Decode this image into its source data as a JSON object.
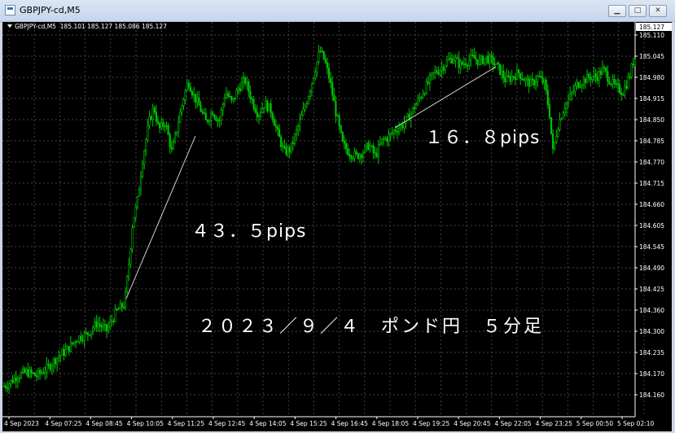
{
  "window": {
    "title": "GBPJPY-cd,M5",
    "buttons": [
      "minimize",
      "maximize",
      "close"
    ]
  },
  "chart_header": {
    "symbol_tf": "GBPJPY-cd,M5",
    "ohlc": "185.101 185.127 185.086 185.127"
  },
  "current_price": "185.127",
  "annotations": {
    "pips1": "４３．５pips",
    "pips2": "１６．８pips",
    "caption": "２０２３／９／４　ポンド円　５分足"
  },
  "colors": {
    "background": "#000000",
    "candle": "#00c000",
    "grid": "#5a5a5a",
    "text": "#ffffff"
  },
  "chart_data": {
    "type": "candlestick",
    "y_ticks": [
      "185.110",
      "185.045",
      "184.980",
      "184.915",
      "184.850",
      "184.785",
      "184.770",
      "184.715",
      "184.660",
      "184.605",
      "184.545",
      "184.490",
      "184.425",
      "184.360",
      "184.300",
      "184.235",
      "184.170",
      "184.160"
    ],
    "x_ticks": [
      "4 Sep 2023",
      "4 Sep 07:25",
      "4 Sep 08:45",
      "4 Sep 10:05",
      "4 Sep 11:25",
      "4 Sep 12:45",
      "4 Sep 14:05",
      "4 Sep 15:25",
      "4 Sep 16:45",
      "4 Sep 18:05",
      "4 Sep 19:25",
      "4 Sep 20:45",
      "4 Sep 22:05",
      "4 Sep 23:25",
      "5 Sep 00:50",
      "5 Sep 02:10"
    ],
    "ylim": [
      184.145,
      185.135
    ],
    "price_path": [
      [
        0,
        184.18
      ],
      [
        8,
        184.19
      ],
      [
        18,
        184.21
      ],
      [
        30,
        184.22
      ],
      [
        42,
        184.21
      ],
      [
        55,
        184.23
      ],
      [
        68,
        184.26
      ],
      [
        80,
        184.28
      ],
      [
        92,
        184.31
      ],
      [
        104,
        184.32
      ],
      [
        116,
        184.35
      ],
      [
        128,
        184.33
      ],
      [
        140,
        184.38
      ],
      [
        150,
        184.4
      ],
      [
        156,
        184.52
      ],
      [
        160,
        184.62
      ],
      [
        165,
        184.66
      ],
      [
        172,
        184.78
      ],
      [
        180,
        184.88
      ],
      [
        186,
        184.92
      ],
      [
        192,
        184.86
      ],
      [
        200,
        184.88
      ],
      [
        208,
        184.8
      ],
      [
        215,
        184.87
      ],
      [
        222,
        184.94
      ],
      [
        228,
        184.99
      ],
      [
        235,
        184.95
      ],
      [
        242,
        184.92
      ],
      [
        250,
        184.88
      ],
      [
        258,
        184.91
      ],
      [
        266,
        184.88
      ],
      [
        274,
        184.96
      ],
      [
        282,
        184.93
      ],
      [
        290,
        184.97
      ],
      [
        298,
        184.99
      ],
      [
        306,
        184.94
      ],
      [
        314,
        184.9
      ],
      [
        322,
        184.93
      ],
      [
        330,
        184.91
      ],
      [
        338,
        184.85
      ],
      [
        346,
        184.8
      ],
      [
        354,
        184.81
      ],
      [
        362,
        184.86
      ],
      [
        370,
        184.91
      ],
      [
        378,
        184.97
      ],
      [
        384,
        185.02
      ],
      [
        390,
        185.07
      ],
      [
        396,
        185.04
      ],
      [
        402,
        184.99
      ],
      [
        410,
        184.9
      ],
      [
        418,
        184.82
      ],
      [
        426,
        184.8
      ],
      [
        434,
        184.79
      ],
      [
        442,
        184.8
      ],
      [
        450,
        184.82
      ],
      [
        458,
        184.79
      ],
      [
        466,
        184.83
      ],
      [
        474,
        184.84
      ],
      [
        482,
        184.86
      ],
      [
        490,
        184.87
      ],
      [
        498,
        184.89
      ],
      [
        506,
        184.92
      ],
      [
        514,
        184.95
      ],
      [
        522,
        184.98
      ],
      [
        530,
        185.01
      ],
      [
        538,
        185.02
      ],
      [
        546,
        185.04
      ],
      [
        554,
        185.05
      ],
      [
        562,
        185.03
      ],
      [
        570,
        185.04
      ],
      [
        578,
        185.05
      ],
      [
        586,
        185.04
      ],
      [
        594,
        185.05
      ],
      [
        602,
        185.04
      ],
      [
        610,
        185.02
      ],
      [
        618,
        184.99
      ],
      [
        626,
        185.0
      ],
      [
        634,
        185.01
      ],
      [
        642,
        184.99
      ],
      [
        650,
        184.98
      ],
      [
        658,
        185.0
      ],
      [
        666,
        184.98
      ],
      [
        672,
        184.9
      ],
      [
        676,
        184.8
      ],
      [
        682,
        184.87
      ],
      [
        690,
        184.92
      ],
      [
        698,
        184.95
      ],
      [
        706,
        184.98
      ],
      [
        714,
        184.99
      ],
      [
        722,
        185.0
      ],
      [
        730,
        185.0
      ],
      [
        738,
        185.02
      ],
      [
        746,
        184.99
      ],
      [
        754,
        184.97
      ],
      [
        762,
        184.96
      ],
      [
        770,
        185.0
      ],
      [
        776,
        185.05
      ],
      [
        780,
        185.05
      ]
    ]
  }
}
